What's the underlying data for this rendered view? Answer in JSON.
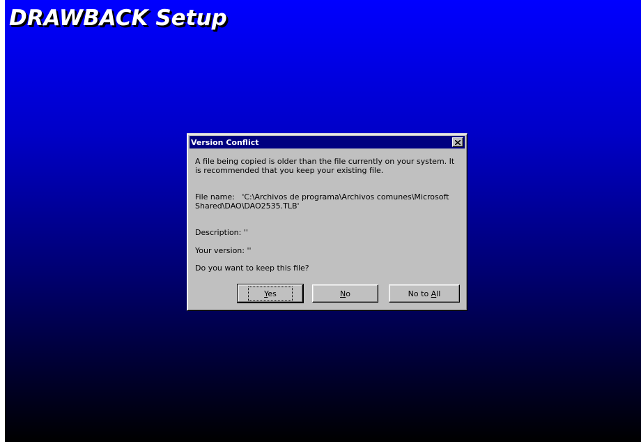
{
  "installer": {
    "title": "DRAWBACK Setup"
  },
  "dialog": {
    "title": "Version Conflict",
    "close_icon": "close-icon",
    "message": "A file being copied is older than the file currently on your system.  It is recommended that you keep your existing file.",
    "file_name_label": "File name:",
    "file_name_value": "'C:\\Archivos de programa\\Archivos comunes\\Microsoft Shared\\DAO\\DAO2535.TLB'",
    "description_line": "Description:  ''",
    "your_version_line": "Your version:  ''",
    "question": "Do you want to keep this file?",
    "buttons": {
      "yes": {
        "mnemonic": "Y",
        "rest": "es"
      },
      "no": {
        "mnemonic": "N",
        "rest": "o"
      },
      "no_to_all": {
        "prefix": "No to ",
        "mnemonic": "A",
        "rest": "ll"
      }
    }
  },
  "colors": {
    "background_top": "#0000ff",
    "background_bottom": "#000000",
    "dialog_face": "#c0c0c0",
    "titlebar": "#000080"
  }
}
